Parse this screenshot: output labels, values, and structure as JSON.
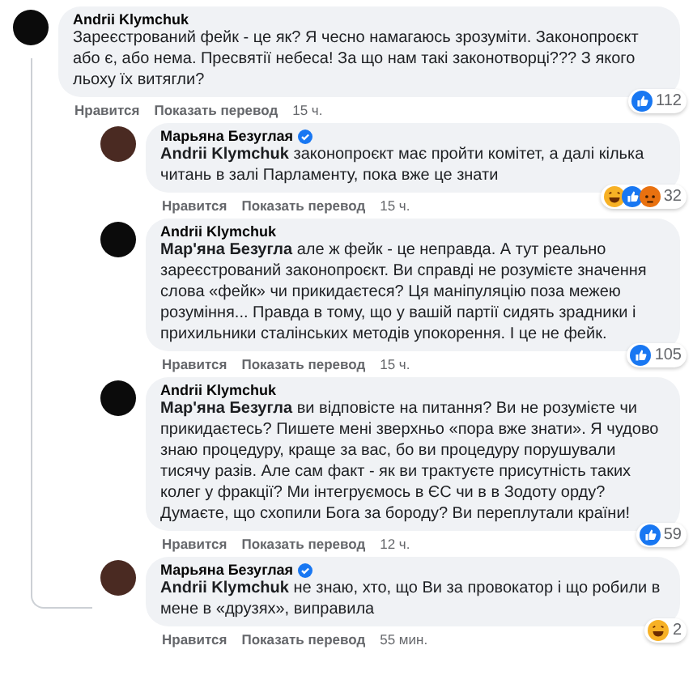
{
  "comments": [
    {
      "author": "Andrii Klymchuk",
      "verified": false,
      "text": "Зареєстрований фейк - це як? Я чесно намагаюсь зрозуміти. Законопроєкт або є, або нема. Пресвятії небеса! За що нам такі законотворці??? З якого льоху їх витягли?",
      "reactions": [
        {
          "kind": "like"
        }
      ],
      "reaction_count": "112",
      "actions": [
        "Нравится",
        "Показать перевод"
      ],
      "time": "15 ч.",
      "children": [
        {
          "author": "Марьяна Безуглая",
          "verified": true,
          "text": "**Andrii Klymchuk** законопроєкт має пройти комітет, а далі кілька читань в залі Парламенту, пока вже це знати",
          "reactions": [
            {
              "kind": "haha"
            },
            {
              "kind": "like"
            },
            {
              "kind": "angry"
            }
          ],
          "reaction_count": "32",
          "actions": [
            "Нравится",
            "Показать перевод"
          ],
          "time": "15 ч."
        },
        {
          "author": "Andrii Klymchuk",
          "verified": false,
          "text": "**Мар'яна Безугла** але ж фейк - це неправда. А тут реально зареєстрований законопроєкт. Ви справді не розумієте значення слова «фейк» чи прикидаєтеся? Ця маніпуляцію поза межею розуміння... Правда в тому, що у вашій партії сидять зрадники і прихильники сталінських методів упокорення. І це не фейк.",
          "reactions": [
            {
              "kind": "like"
            }
          ],
          "reaction_count": "105",
          "actions": [
            "Нравится",
            "Показать перевод"
          ],
          "time": "15 ч."
        },
        {
          "author": "Andrii Klymchuk",
          "verified": false,
          "text": "**Мар'яна Безугла** ви відповісте на питання? Ви не розумієте чи прикидаєтесь? Пишете мені зверхньо «пора вже знати». Я чудово знаю процедуру, краще за вас, бо ви процедуру порушували тисячу разів. Але сам факт - як ви трактуєте присутність таких колег у фракції? Ми інтегруємось в ЄС чи в в Зодоту орду? Думаєте, що схопили Бога за бороду? Ви переплутали країни!",
          "reactions": [
            {
              "kind": "like"
            }
          ],
          "reaction_count": "59",
          "actions": [
            "Нравится",
            "Показать перевод"
          ],
          "time": "12 ч."
        },
        {
          "author": "Марьяна Безуглая",
          "verified": true,
          "text": "**Andrii Klymchuk** не знаю, хто, що Ви за провокатор і що робили в мене в «друзях», виправила",
          "reactions": [
            {
              "kind": "haha"
            }
          ],
          "reaction_count": "2",
          "actions": [
            "Нравится",
            "Показать перевод"
          ],
          "time": "55 мин."
        }
      ]
    }
  ]
}
